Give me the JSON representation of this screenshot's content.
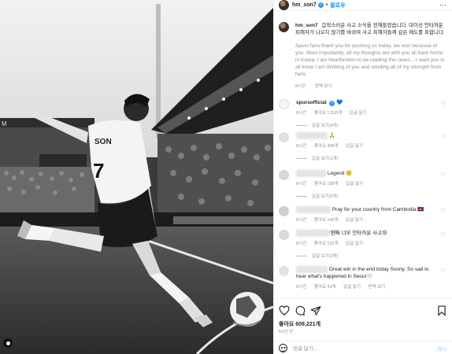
{
  "header": {
    "username": "hm_son7",
    "separator": "•",
    "follow_label": "팔로우",
    "more_label": "···"
  },
  "caption": {
    "username": "hm_son7",
    "text_ko": "갑작스러운 사고 소식을 전해들었습니다. 대이상 안타까운 피해자가 나오지 않기를 바라며 사고 피해자들께 깊은 애도를 표합니다.",
    "text_en": "Spurs fans thank you for pushing us today, we won because of you. Most importantly, all my thoughts are with you all back home in Korea. I am heartbroken to be reading this news... I want you to all know I am thinking of you and sending all of my strength from here.",
    "time": "8시간",
    "translate": "번역 보기"
  },
  "comments": [
    {
      "username": "spursofficial",
      "text": "💙",
      "time": "8시간",
      "likes": "좋아요 1,533개",
      "reply": "답글 달기",
      "replies": "답글 보기(4개)"
    },
    {
      "username": "",
      "text": "🙏",
      "time": "8시간",
      "likes": "좋아요 396개",
      "reply": "답글 달기",
      "replies": "답글 보기(1개)"
    },
    {
      "username": "",
      "text": "Legend 🫡",
      "time": "8시간",
      "likes": "좋아요 158개",
      "reply": "답글 달기",
      "replies": "답글 보기(5개)"
    },
    {
      "username": "",
      "text": "Pray for your country from Cambodia 🇰🇭",
      "time": "8시간",
      "likes": "좋아요 146개",
      "reply": "답글 달기",
      "replies": "답글 보기(5개)"
    },
    {
      "username": "",
      "text": "진짜 너무 안타까운 사고😢",
      "time": "8시간",
      "likes": "좋아요 132개",
      "reply": "답글 달기",
      "replies": "답글 보기(2개)"
    },
    {
      "username": "",
      "text": "Great win in the end today Sonny. So sad to hear what's happened in Seoul🤍",
      "time": "8시간",
      "likes": "좋아요 43개",
      "reply": "답글 달기",
      "translate": "번역 보기"
    }
  ],
  "photo": {
    "jersey_name": "SON",
    "jersey_number": "7"
  },
  "actions": {
    "likes": "좋아요 609,221개",
    "time": "8시간 전",
    "comment_placeholder": "댓글 달기...",
    "post_label": "게시"
  },
  "colors": {
    "accent": "#0095f6",
    "verified": "#3897f0",
    "muted": "#8e8e8e"
  },
  "icons": [
    "heart-icon",
    "comment-icon",
    "share-icon",
    "bookmark-icon",
    "emoji-icon",
    "verified-icon",
    "tag-icon",
    "more-icon"
  ]
}
